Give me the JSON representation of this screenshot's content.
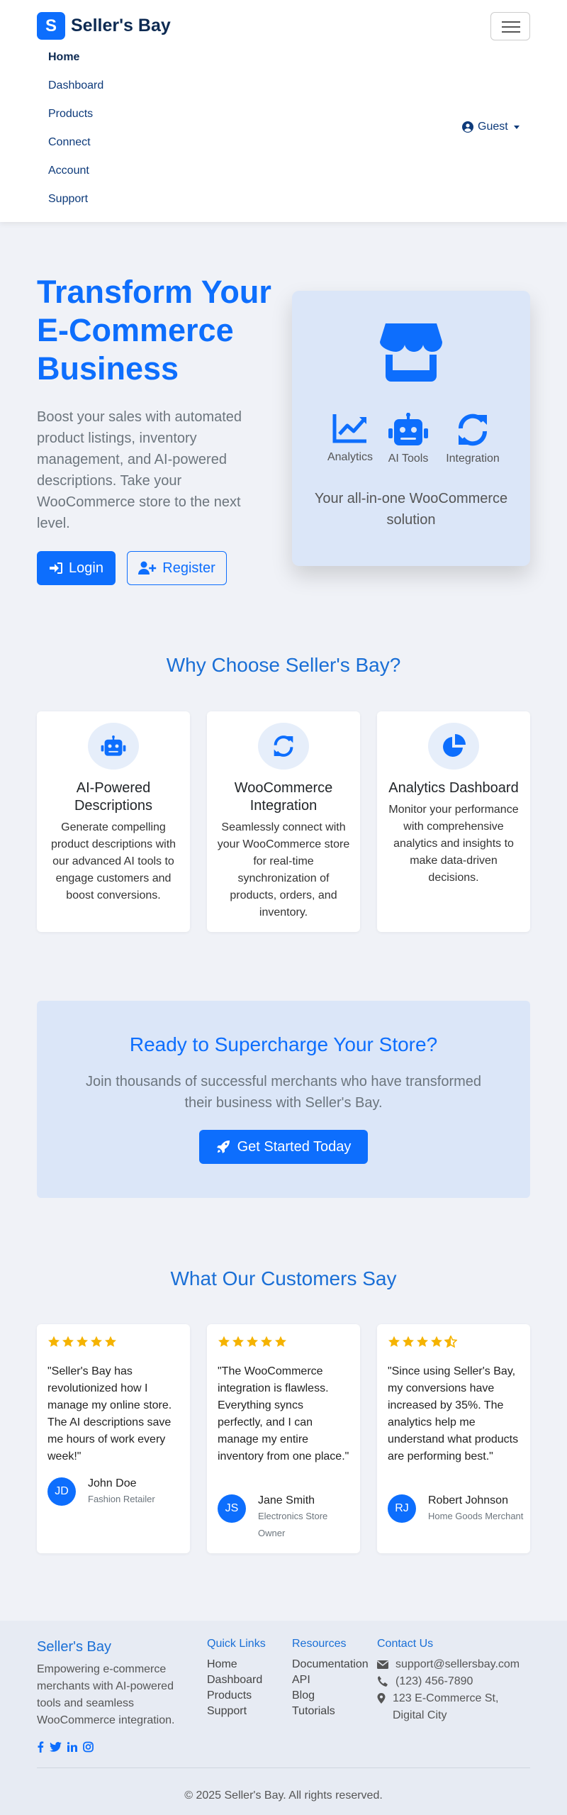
{
  "header": {
    "logo_letter": "S",
    "brand": "Seller's Bay",
    "nav": [
      "Home",
      "Dashboard",
      "Products",
      "Connect",
      "Account",
      "Support"
    ],
    "user_label": "Guest"
  },
  "hero": {
    "title": "Transform Your E-Commerce Business",
    "subtitle": "Boost your sales with automated product listings, inventory management, and AI-powered descriptions. Take your WooCommerce store to the next level.",
    "login_label": "Login",
    "register_label": "Register",
    "card": {
      "features": [
        {
          "icon": "chart-line-icon",
          "label": "Analytics"
        },
        {
          "icon": "robot-icon",
          "label": "AI Tools"
        },
        {
          "icon": "sync-icon",
          "label": "Integration"
        }
      ],
      "caption": "Your all-in-one WooCommerce solution"
    }
  },
  "why": {
    "title": "Why Choose Seller's Bay?",
    "cards": [
      {
        "icon": "robot-icon",
        "title": "AI-Powered Descriptions",
        "text": "Generate compelling product descriptions with our advanced AI tools to engage customers and boost conversions."
      },
      {
        "icon": "sync-icon",
        "title": "WooCommerce Integration",
        "text": "Seamlessly connect with your WooCommerce store for real-time synchronization of products, orders, and inventory."
      },
      {
        "icon": "pie-chart-icon",
        "title": "Analytics Dashboard",
        "text": "Monitor your performance with comprehensive analytics and insights to make data-driven decisions."
      }
    ]
  },
  "cta": {
    "title": "Ready to Supercharge Your Store?",
    "text": "Join thousands of successful merchants who have transformed their business with Seller's Bay.",
    "button": "Get Started Today"
  },
  "testimonials": {
    "title": "What Our Customers Say",
    "items": [
      {
        "rating": 5,
        "quote": "\"Seller's Bay has revolutionized how I manage my online store. The AI descriptions save me hours of work every week!\"",
        "initials": "JD",
        "name": "John Doe",
        "role": "Fashion Retailer"
      },
      {
        "rating": 5,
        "quote": "\"The WooCommerce integration is flawless. Everything syncs perfectly, and I can manage my entire inventory from one place.\"",
        "initials": "JS",
        "name": "Jane Smith",
        "role": "Electronics Store Owner"
      },
      {
        "rating": 4.5,
        "quote": "\"Since using Seller's Bay, my conversions have increased by 35%. The analytics help me understand what products are performing best.\"",
        "initials": "RJ",
        "name": "Robert Johnson",
        "role": "Home Goods Merchant"
      }
    ]
  },
  "footer": {
    "brand": "Seller's Bay",
    "description": "Empowering e-commerce merchants with AI-powered tools and seamless WooCommerce integration.",
    "social": [
      "facebook-icon",
      "twitter-icon",
      "linkedin-icon",
      "instagram-icon"
    ],
    "quick_links": {
      "title": "Quick Links",
      "items": [
        "Home",
        "Dashboard",
        "Products",
        "Support"
      ]
    },
    "resources": {
      "title": "Resources",
      "items": [
        "Documentation",
        "API",
        "Blog",
        "Tutorials"
      ]
    },
    "contact": {
      "title": "Contact Us",
      "email": "support@sellersbay.com",
      "phone": "(123) 456-7890",
      "address": "123 E-Commerce St, Digital City"
    },
    "copyright": "© 2025 Seller's Bay. All rights reserved."
  },
  "colors": {
    "primary": "#0d6efd",
    "star": "#f5b301",
    "card_bg": "#dbe6f8"
  }
}
